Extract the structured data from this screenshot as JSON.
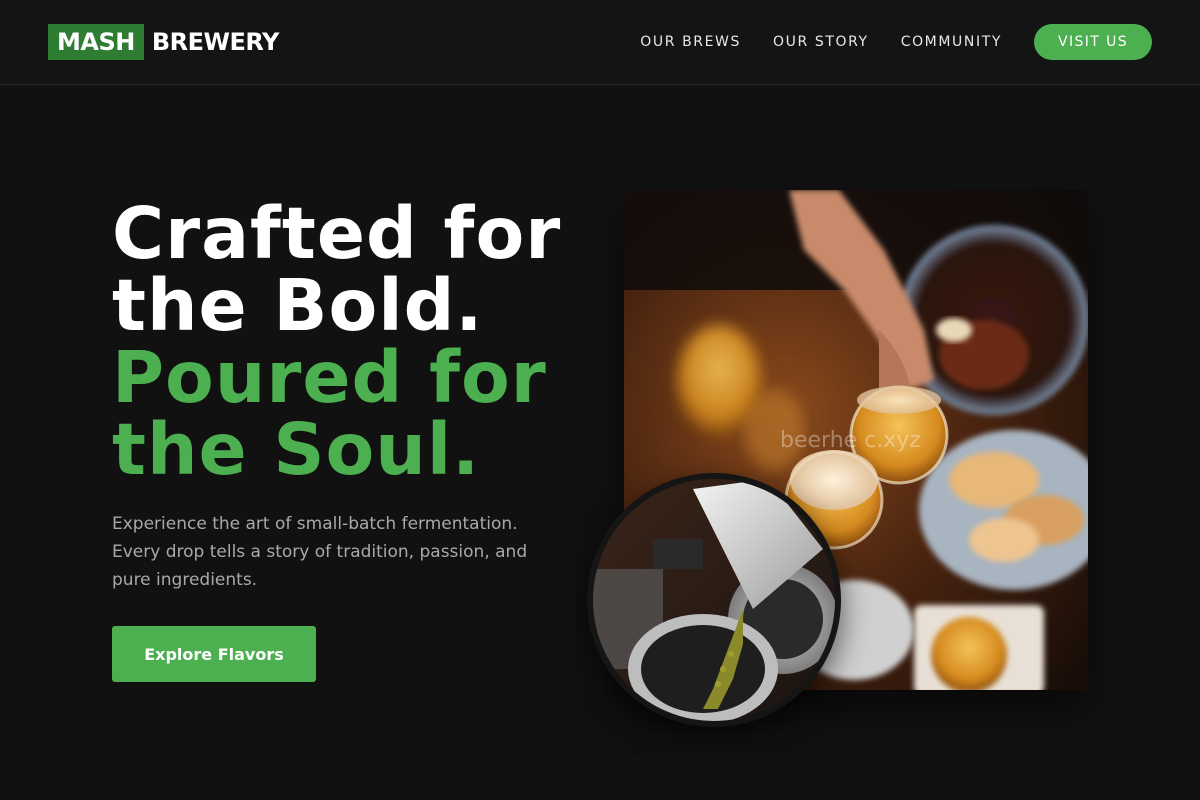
{
  "brand": {
    "highlight": "MASH",
    "name": "BREWERY",
    "accent_color": "#4caf50",
    "accent_dark": "#2e7d32"
  },
  "nav": {
    "items": [
      {
        "label": "OUR BREWS"
      },
      {
        "label": "OUR STORY"
      },
      {
        "label": "COMMUNITY"
      }
    ],
    "cta_label": "VISIT US"
  },
  "hero": {
    "title_line1": "Crafted for",
    "title_line2": "the Bold.",
    "title_line3": "Poured for",
    "title_line4": "the Soul.",
    "description_line1": "Experience the art of small-batch fermentation.",
    "description_line2": "Every drop tells a story of tradition, passion, and",
    "description_line3": "pure ingredients.",
    "button_label": "Explore Flavors"
  },
  "images": {
    "main_watermark": "beerhe     c.xyz"
  }
}
